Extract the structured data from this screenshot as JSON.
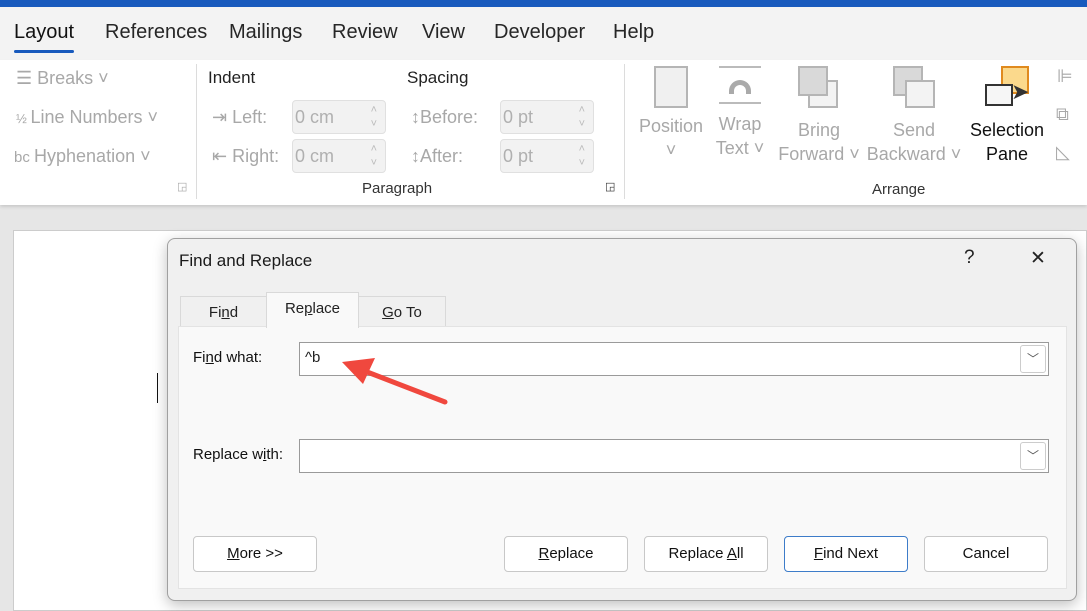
{
  "ribbon_tabs": [
    {
      "label": "Layout",
      "active": true
    },
    {
      "label": "References"
    },
    {
      "label": "Mailings"
    },
    {
      "label": "Review"
    },
    {
      "label": "View"
    },
    {
      "label": "Developer"
    },
    {
      "label": "Help"
    }
  ],
  "page_setup": {
    "breaks": "Breaks",
    "line_numbers": "Line Numbers",
    "hyphenation": "Hyphenation"
  },
  "paragraph": {
    "indent_heading": "Indent",
    "spacing_heading": "Spacing",
    "left_label": "Left:",
    "left_value": "0 cm",
    "right_label": "Right:",
    "right_value": "0 cm",
    "before_label": "Before:",
    "before_value": "0 pt",
    "after_label": "After:",
    "after_value": "0 pt",
    "group_label": "Paragraph"
  },
  "arrange": {
    "position": "Position",
    "wrap1": "Wrap",
    "wrap2": "Text",
    "bring1": "Bring",
    "bring2": "Forward",
    "send1": "Send",
    "send2": "Backward",
    "sel1": "Selection",
    "sel2": "Pane",
    "group_label": "Arrange"
  },
  "dialog": {
    "title": "Find and Replace",
    "help": "?",
    "close": "✕",
    "tabs": [
      {
        "pre": "Fi",
        "key": "n",
        "post": "d"
      },
      {
        "pre": "Re",
        "key": "p",
        "post": "lace"
      },
      {
        "pre": "",
        "key": "G",
        "post": "o To"
      }
    ],
    "find_label": {
      "pre": "Fi",
      "key": "n",
      "post": "d what:"
    },
    "find_value": "^b",
    "replace_label": {
      "pre": "Replace w",
      "key": "i",
      "post": "th:"
    },
    "replace_value": "",
    "buttons": {
      "more": {
        "pre": "",
        "key": "M",
        "post": "ore >>"
      },
      "replace": {
        "pre": "",
        "key": "R",
        "post": "eplace"
      },
      "replace_all": {
        "pre": "Replace ",
        "key": "A",
        "post": "ll"
      },
      "find_next": {
        "pre": "",
        "key": "F",
        "post": "ind Next"
      },
      "cancel": {
        "pre": "Cancel",
        "key": "",
        "post": ""
      }
    }
  },
  "annotation_color": "#f0483e",
  "accent": "#185abd"
}
